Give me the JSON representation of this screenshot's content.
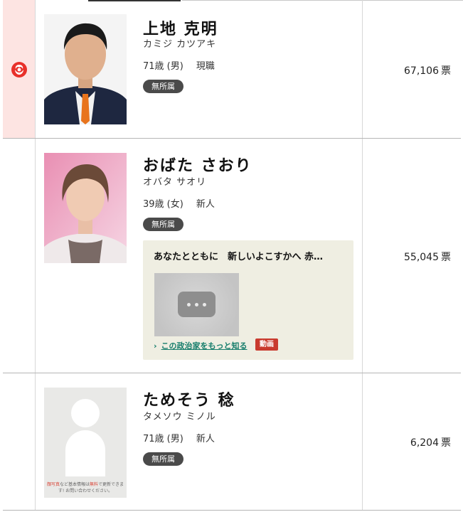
{
  "candidates": [
    {
      "name": "上地 克明",
      "kana": "カミジ カツアキ",
      "age_gender": "71歳 (男)",
      "status": "現職",
      "party": "無所属",
      "votes": "67,106",
      "vote_unit": "票",
      "elected": true
    },
    {
      "name": "おばた さおり",
      "kana": "オバタ サオリ",
      "age_gender": "39歳 (女)",
      "status": "新人",
      "party": "無所属",
      "votes": "55,045",
      "vote_unit": "票",
      "elected": false,
      "promo": {
        "title": "あなたとともに　新しいよこすかへ 赤…",
        "link_label": "この政治家をもっと知る",
        "badge": "動画"
      }
    },
    {
      "name": "ためそう 稔",
      "kana": "タメソウ ミノル",
      "age_gender": "71歳 (男)",
      "status": "新人",
      "party": "無所属",
      "votes": "6,204",
      "vote_unit": "票",
      "elected": false,
      "placeholder_note": {
        "part1": "顔写真",
        "part2": "など基本情報は",
        "part3": "無料",
        "part4": "で更新できます! お問い合わせください。"
      }
    }
  ],
  "colors": {
    "winner_bg": "#fde4e2",
    "rose": "#e8302a",
    "party_pill": "#4a4a4a",
    "promo_bg": "#efeee2",
    "link": "#167d6b",
    "video_badge": "#c93a2e"
  }
}
